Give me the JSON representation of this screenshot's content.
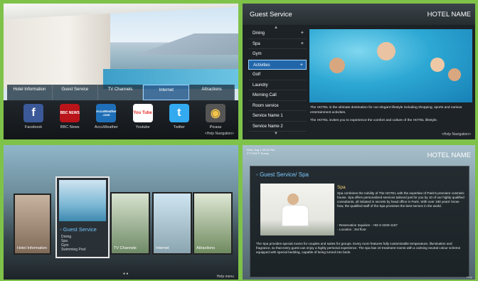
{
  "panel1": {
    "menu": [
      "Hotel Information",
      "Guest Service",
      "TV Channels",
      "Internet",
      "Attractions"
    ],
    "active_menu": "Internet",
    "apps": [
      {
        "label": "Facebook",
        "glyph": "f",
        "color": "#3b5998"
      },
      {
        "label": "BBC News",
        "glyph": "BBC NEWS",
        "color": "#b8141a"
      },
      {
        "label": "AccuWeather",
        "glyph": "AccuWeather .com",
        "color": "#1f6fb8"
      },
      {
        "label": "Youtube",
        "glyph": "You Tube",
        "color": "#e52d27"
      },
      {
        "label": "Twitter",
        "glyph": "t",
        "color": "#33aaf0"
      },
      {
        "label": "Picasa",
        "glyph": "◉",
        "color": "#555555"
      }
    ],
    "help": "<Help Navigation>"
  },
  "panel2": {
    "title": "Guest Service",
    "hotel": "HOTEL NAME",
    "items": [
      {
        "label": "Dining",
        "plus": "+"
      },
      {
        "label": "Spa",
        "plus": "+"
      },
      {
        "label": "Gym",
        "plus": ""
      },
      {
        "label": "Activities",
        "plus": "+"
      },
      {
        "label": "Golf",
        "plus": ""
      },
      {
        "label": "Laundry",
        "plus": ""
      },
      {
        "label": "Morning Call",
        "plus": ""
      },
      {
        "label": "Room service",
        "plus": ""
      },
      {
        "label": "Service Name 1",
        "plus": ""
      },
      {
        "label": "Service Name 2",
        "plus": ""
      }
    ],
    "active_item": "Activities",
    "text1": "The HOTEL is the ultimate destination for our elegant lifestyle including shopping, sports and various entertainment activities.",
    "text2": "The HOTEL invites you to experience the comfort and culture of the HOTEL lifestyle.",
    "help": "<Help Navigation>"
  },
  "panel3": {
    "cards": [
      "Hotel Information",
      "Guest Service",
      "TV Channels",
      "Internet",
      "Attractions"
    ],
    "big_card": {
      "title": "Guest Service",
      "subs": [
        "Dining",
        "Spa",
        "Gym",
        "Swimming Pool"
      ]
    },
    "dots": "● ●",
    "help": "Help menu"
  },
  "panel4": {
    "date": "Wed, Aug 1 09:30 PM",
    "date2": "27°C/81°F Sunny",
    "hotel": "HOTEL NAME",
    "title": "Guest Service/ Spa",
    "spa": "Spa",
    "t1": "Spa combines the nobility of The HOTEL with the expertise of Paris's premiere cosmetic house. Spa offers personalized services tailored just for you by 10 of our highly qualified consultants, all initiated in secrets by head office in Paris. With over 180 years' know-how, the qualified staff of the Spa promises the best service in the world.",
    "t2a": "- Reservation Inquiries : +82-2-2230-1167",
    "t2b": "- Location : 3rd floor",
    "t3": "The Spa provides special rooms for couples and suites for groups. Every room features fully customizable temperature, illumination and fragrance, so that every guest can enjoy a highly personal experience. The spa has 10 treatment rooms with a calming neutral colour scheme equipped with special bedding, capable of being turned into beds.",
    "help": "Help"
  }
}
